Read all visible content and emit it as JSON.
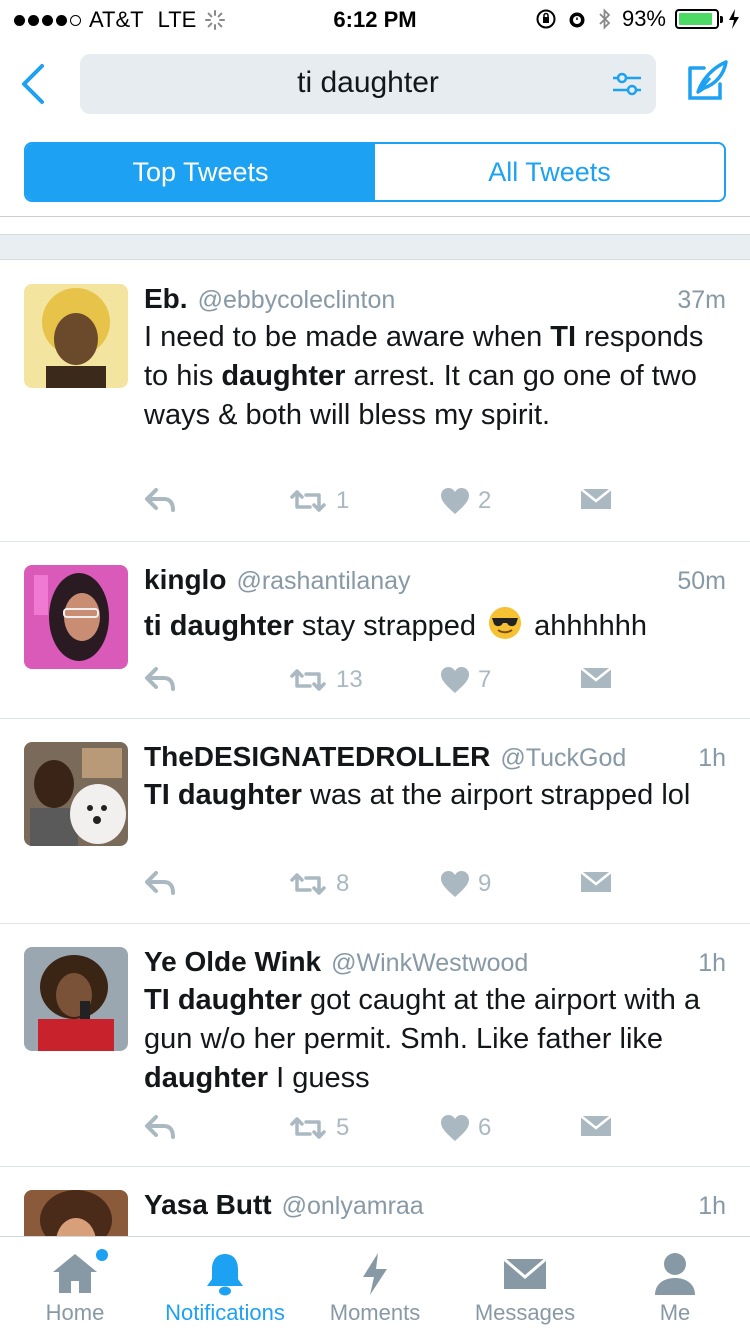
{
  "status_bar": {
    "carrier": "AT&T",
    "network": "LTE",
    "time": "6:12 PM",
    "battery": "93%",
    "battery_level": 0.93,
    "battery_color": "#4cd964"
  },
  "search": {
    "query": "ti daughter",
    "icons": [
      "back-chevron-icon",
      "filter-sliders-icon",
      "compose-quill-icon"
    ]
  },
  "tabs_filter": {
    "top": "Top Tweets",
    "all": "All Tweets",
    "active": "Top Tweets"
  },
  "colors": {
    "accent": "#1da1f2",
    "muted": "#8899a6",
    "action": "#aab8c2"
  },
  "tweets": [
    {
      "name": "Eb.",
      "handle": "@ebbycoleclinton",
      "time": "37m",
      "text_parts": [
        "I need to be made aware when ",
        "TI",
        " responds to his ",
        "daughter",
        " arrest. It can go one of two ways & both will bless my spirit."
      ],
      "retweets": "1",
      "likes": "2"
    },
    {
      "name": "kinglo",
      "handle": "@rashantilanay",
      "time": "50m",
      "text_parts": [
        "ti daughter",
        " stay strapped ",
        "😎",
        " ahhhhhh"
      ],
      "retweets": "13",
      "likes": "7"
    },
    {
      "name": "TheDESIGNATEDROLLER",
      "handle": "@TuckGod",
      "time": "1h",
      "text_parts": [
        "TI daughter",
        " was at the airport strapped lol"
      ],
      "retweets": "8",
      "likes": "9"
    },
    {
      "name": "Ye Olde Wink",
      "handle": "@WinkWestwood",
      "time": "1h",
      "text_parts": [
        "TI daughter",
        " got caught at the airport with a gun w/o her permit. Smh. Like father like ",
        "daughter",
        " I guess"
      ],
      "retweets": "5",
      "likes": "6"
    },
    {
      "name": "Yasa Butt",
      "handle": "@onlyamraa",
      "time": "1h"
    }
  ],
  "tabbar": {
    "items": [
      {
        "label": "Home",
        "icon": "home-icon"
      },
      {
        "label": "Notifications",
        "icon": "bell-icon"
      },
      {
        "label": "Moments",
        "icon": "lightning-icon"
      },
      {
        "label": "Messages",
        "icon": "envelope-icon"
      },
      {
        "label": "Me",
        "icon": "person-icon"
      }
    ],
    "active": "Notifications"
  }
}
